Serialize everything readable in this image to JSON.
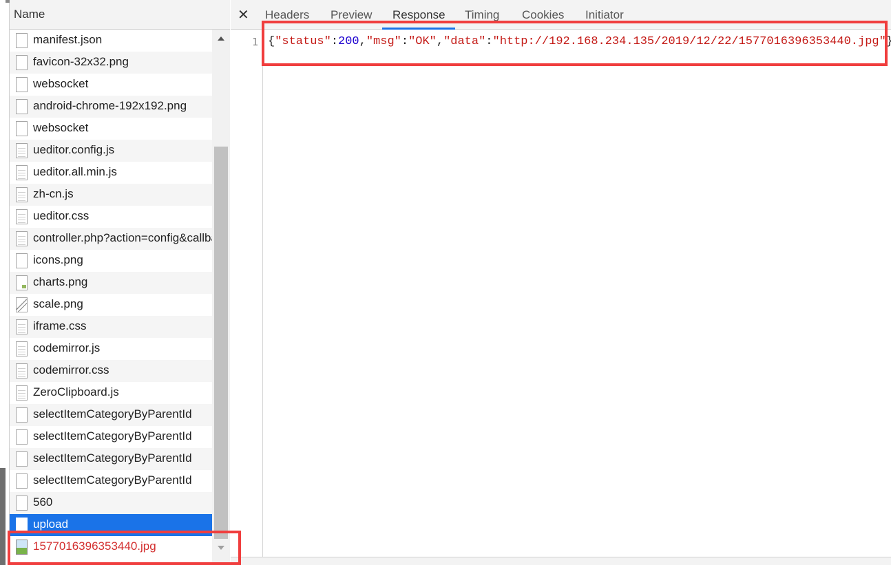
{
  "name_panel": {
    "header": "Name",
    "requests": [
      {
        "name": "manifest.json",
        "icon": "blank-file-icon"
      },
      {
        "name": "favicon-32x32.png",
        "icon": "blank-file-icon"
      },
      {
        "name": "websocket",
        "icon": "blank-file-icon"
      },
      {
        "name": "android-chrome-192x192.png",
        "icon": "blank-file-icon"
      },
      {
        "name": "websocket",
        "icon": "blank-file-icon"
      },
      {
        "name": "ueditor.config.js",
        "icon": "script-file-icon"
      },
      {
        "name": "ueditor.all.min.js",
        "icon": "script-file-icon"
      },
      {
        "name": "zh-cn.js",
        "icon": "script-file-icon"
      },
      {
        "name": "ueditor.css",
        "icon": "stylesheet-file-icon"
      },
      {
        "name": "controller.php?action=config&callback",
        "icon": "script-file-icon"
      },
      {
        "name": "icons.png",
        "icon": "image-file-icon"
      },
      {
        "name": "charts.png",
        "icon": "image-file-icon"
      },
      {
        "name": "scale.png",
        "icon": "image-file-icon"
      },
      {
        "name": "iframe.css",
        "icon": "stylesheet-file-icon"
      },
      {
        "name": "codemirror.js",
        "icon": "script-file-icon"
      },
      {
        "name": "codemirror.css",
        "icon": "stylesheet-file-icon"
      },
      {
        "name": "ZeroClipboard.js",
        "icon": "script-file-icon"
      },
      {
        "name": "selectItemCategoryByParentId",
        "icon": "blank-file-icon"
      },
      {
        "name": "selectItemCategoryByParentId",
        "icon": "blank-file-icon"
      },
      {
        "name": "selectItemCategoryByParentId",
        "icon": "blank-file-icon"
      },
      {
        "name": "selectItemCategoryByParentId",
        "icon": "blank-file-icon"
      },
      {
        "name": "560",
        "icon": "blank-file-icon"
      },
      {
        "name": "upload",
        "icon": "blank-file-icon",
        "selected": true
      },
      {
        "name": "1577016396353440.jpg",
        "icon": "photo-file-icon",
        "highlighted": true
      }
    ]
  },
  "detail_panel": {
    "close_glyph": "✕",
    "tabs": [
      {
        "label": "Headers"
      },
      {
        "label": "Preview"
      },
      {
        "label": "Response",
        "active": true
      },
      {
        "label": "Timing"
      },
      {
        "label": "Cookies"
      },
      {
        "label": "Initiator"
      }
    ],
    "response": {
      "line_number": "1",
      "tokens": [
        {
          "text": "{",
          "kind": "punct"
        },
        {
          "text": "\"status\"",
          "kind": "str"
        },
        {
          "text": ":",
          "kind": "punct"
        },
        {
          "text": "200",
          "kind": "num"
        },
        {
          "text": ",",
          "kind": "punct"
        },
        {
          "text": "\"msg\"",
          "kind": "str"
        },
        {
          "text": ":",
          "kind": "punct"
        },
        {
          "text": "\"OK\"",
          "kind": "str"
        },
        {
          "text": ",",
          "kind": "punct"
        },
        {
          "text": "\"data\"",
          "kind": "str"
        },
        {
          "text": ":",
          "kind": "punct"
        },
        {
          "text": "\"http://192.168.234.135/2019/12/22/1577016396353440.jpg\"",
          "kind": "str"
        },
        {
          "text": "}",
          "kind": "punct"
        }
      ]
    }
  },
  "colors": {
    "annotation_red": "#f03e3e",
    "selected_row": "#1a73e8",
    "string_token": "#c41a16",
    "number_token": "#1c00cf"
  }
}
